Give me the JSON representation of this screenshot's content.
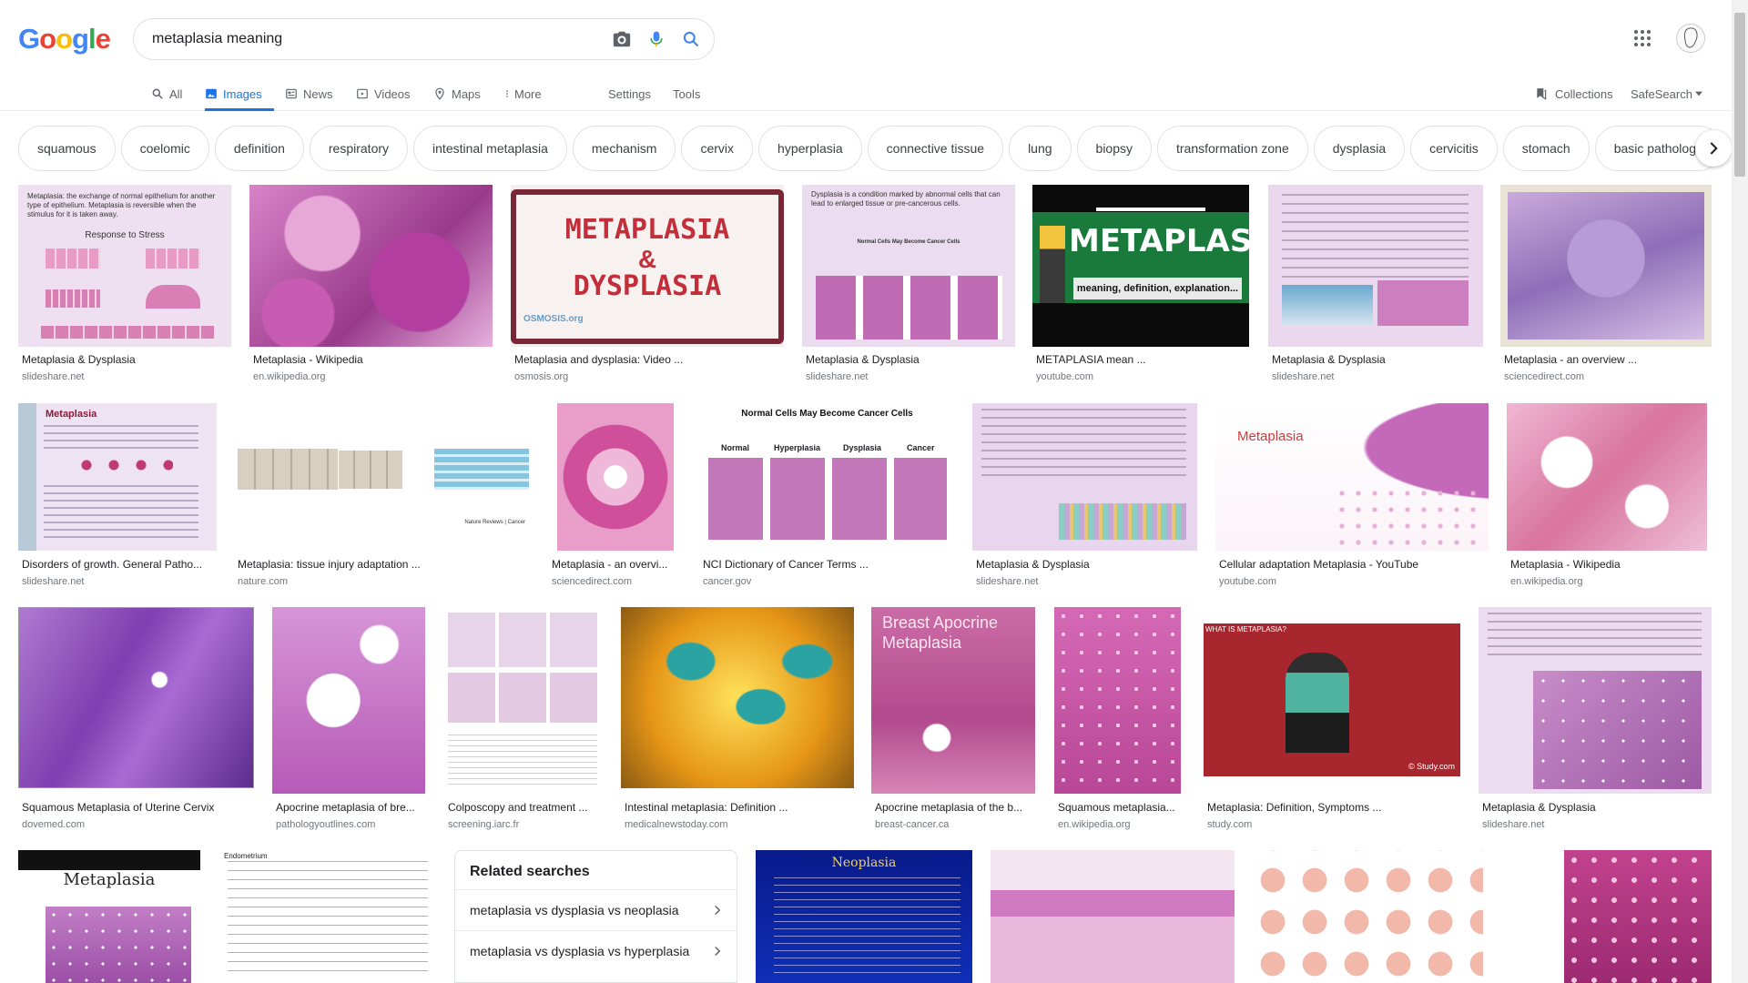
{
  "header": {
    "logo_letters": [
      "G",
      "o",
      "o",
      "g",
      "l",
      "e"
    ],
    "search_value": "metaplasia meaning"
  },
  "tabs": [
    {
      "label": "All",
      "icon": "search-icon"
    },
    {
      "label": "Images",
      "icon": "image-icon",
      "active": true
    },
    {
      "label": "News",
      "icon": "news-icon"
    },
    {
      "label": "Videos",
      "icon": "video-icon"
    },
    {
      "label": "Maps",
      "icon": "map-icon"
    },
    {
      "label": "More",
      "icon": "more-vert-icon"
    }
  ],
  "tools": {
    "settings": "Settings",
    "tools": "Tools",
    "collections": "Collections",
    "safesearch": "SafeSearch"
  },
  "chips": [
    "squamous",
    "coelomic",
    "definition",
    "respiratory",
    "intestinal metaplasia",
    "mechanism",
    "cervix",
    "hyperplasia",
    "connective tissue",
    "lung",
    "biopsy",
    "transformation zone",
    "dysplasia",
    "cervicitis",
    "stomach",
    "basic pathology"
  ],
  "results": [
    {
      "title": "Metaplasia & Dysplasia",
      "source": "slideshare.net",
      "overlay": "Metaplasia: the exchange of normal epithelium for another type of epithelium. Metaplasia is reversible when the stimulus for it is taken away.",
      "overlay2": "Response to Stress"
    },
    {
      "title": "Metaplasia - Wikipedia",
      "source": "en.wikipedia.org"
    },
    {
      "title": "Metaplasia and dysplasia: Video ...",
      "source": "osmosis.org",
      "overlay": "METAPLASIA",
      "overlay2": "&",
      "overlay3": "DYSPLASIA",
      "overlay4": "OSMOSIS.org"
    },
    {
      "title": "Metaplasia & Dysplasia",
      "source": "slideshare.net",
      "overlay": "Dysplasia is a condition marked by abnormal cells that can lead to enlarged tissue or pre-cancerous cells.",
      "overlay2": "Normal Cells May Become Cancer Cells"
    },
    {
      "title": "METAPLASIA mean ...",
      "source": "youtube.com",
      "overlay": "METAPLASIA",
      "overlay2": "meaning, definition, explanation..."
    },
    {
      "title": "Metaplasia & Dysplasia",
      "source": "slideshare.net"
    },
    {
      "title": "Metaplasia - an overview ...",
      "source": "sciencedirect.com"
    },
    {
      "title": "Disorders of growth. General Patho...",
      "source": "slideshare.net",
      "overlay": "Metaplasia"
    },
    {
      "title": "Metaplasia: tissue injury adaptation ...",
      "source": "nature.com",
      "overlay": "Nature Reviews | Cancer"
    },
    {
      "title": "Metaplasia - an overvi...",
      "source": "sciencedirect.com"
    },
    {
      "title": "NCI Dictionary of Cancer Terms ...",
      "source": "cancer.gov",
      "overlay": "Normal Cells May Become Cancer Cells",
      "labels": [
        "Normal",
        "Hyperplasia",
        "Dysplasia",
        "Cancer"
      ]
    },
    {
      "title": "Metaplasia & Dysplasia",
      "source": "slideshare.net"
    },
    {
      "title": "Cellular adaptation Metaplasia - YouTube",
      "source": "youtube.com",
      "overlay": "Metaplasia"
    },
    {
      "title": "Metaplasia - Wikipedia",
      "source": "en.wikipedia.org"
    },
    {
      "title": "Squamous Metaplasia of Uterine Cervix",
      "source": "dovemed.com"
    },
    {
      "title": "Apocrine metaplasia of bre...",
      "source": "pathologyoutlines.com"
    },
    {
      "title": "Colposcopy and treatment ...",
      "source": "screening.iarc.fr"
    },
    {
      "title": "Intestinal metaplasia: Definition ...",
      "source": "medicalnewstoday.com"
    },
    {
      "title": "Apocrine metaplasia of the b...",
      "source": "breast-cancer.ca",
      "overlay": "Breast Apocrine Metaplasia"
    },
    {
      "title": "Squamous metaplasia...",
      "source": "en.wikipedia.org"
    },
    {
      "title": "Metaplasia: Definition, Symptoms ...",
      "source": "study.com",
      "overlay": "WHAT IS METAPLASIA?",
      "overlay2": "© Study.com"
    },
    {
      "title": "Metaplasia & Dysplasia",
      "source": "slideshare.net"
    },
    {
      "title": "",
      "source": "",
      "overlay": "Metaplasia"
    },
    {
      "title": "",
      "source": "",
      "overlay": "Endometrium"
    },
    {
      "title": "",
      "source": "",
      "overlay": "Neoplasia"
    },
    {
      "title": "",
      "source": ""
    },
    {
      "title": "",
      "source": ""
    },
    {
      "title": "",
      "source": ""
    }
  ],
  "related": {
    "heading": "Related searches",
    "items": [
      "metaplasia vs dysplasia vs neoplasia",
      "metaplasia vs dysplasia vs hyperplasia"
    ]
  },
  "colors": {
    "pink_stain": "#c46bc0",
    "slide_bg": "#ead7ee",
    "google_blue": "#1a73e8"
  }
}
